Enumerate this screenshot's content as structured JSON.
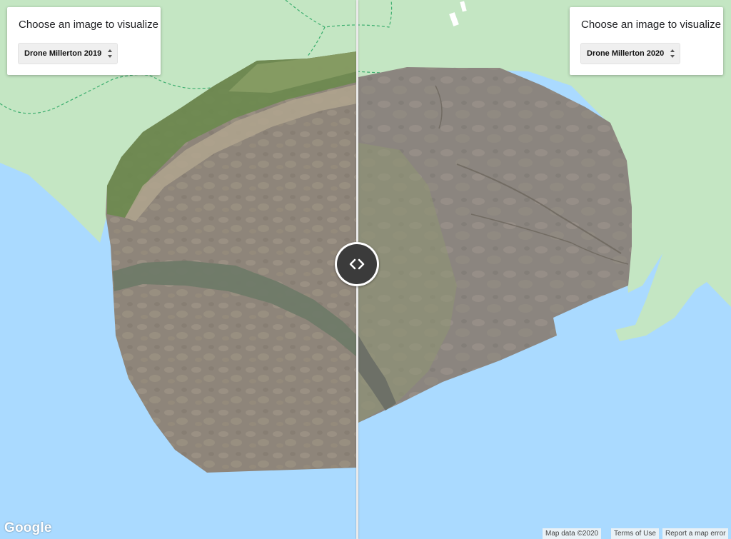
{
  "left_panel": {
    "title": "Choose an image to visualize",
    "selected": "Drone Millerton 2019"
  },
  "right_panel": {
    "title": "Choose an image to visualize",
    "selected": "Drone Millerton 2020"
  },
  "footer": {
    "logo": "Google",
    "map_data": "Map data ©2020",
    "terms": "Terms of Use",
    "report": "Report a map error"
  },
  "colors": {
    "water": "#aadaff",
    "land": "#c4e6c3",
    "trail": "#3cae6e",
    "mudflat": "#8e857a"
  },
  "icons": {
    "slider": "chevrons-left-right-icon",
    "select_arrows": "sort-arrows-icon"
  }
}
